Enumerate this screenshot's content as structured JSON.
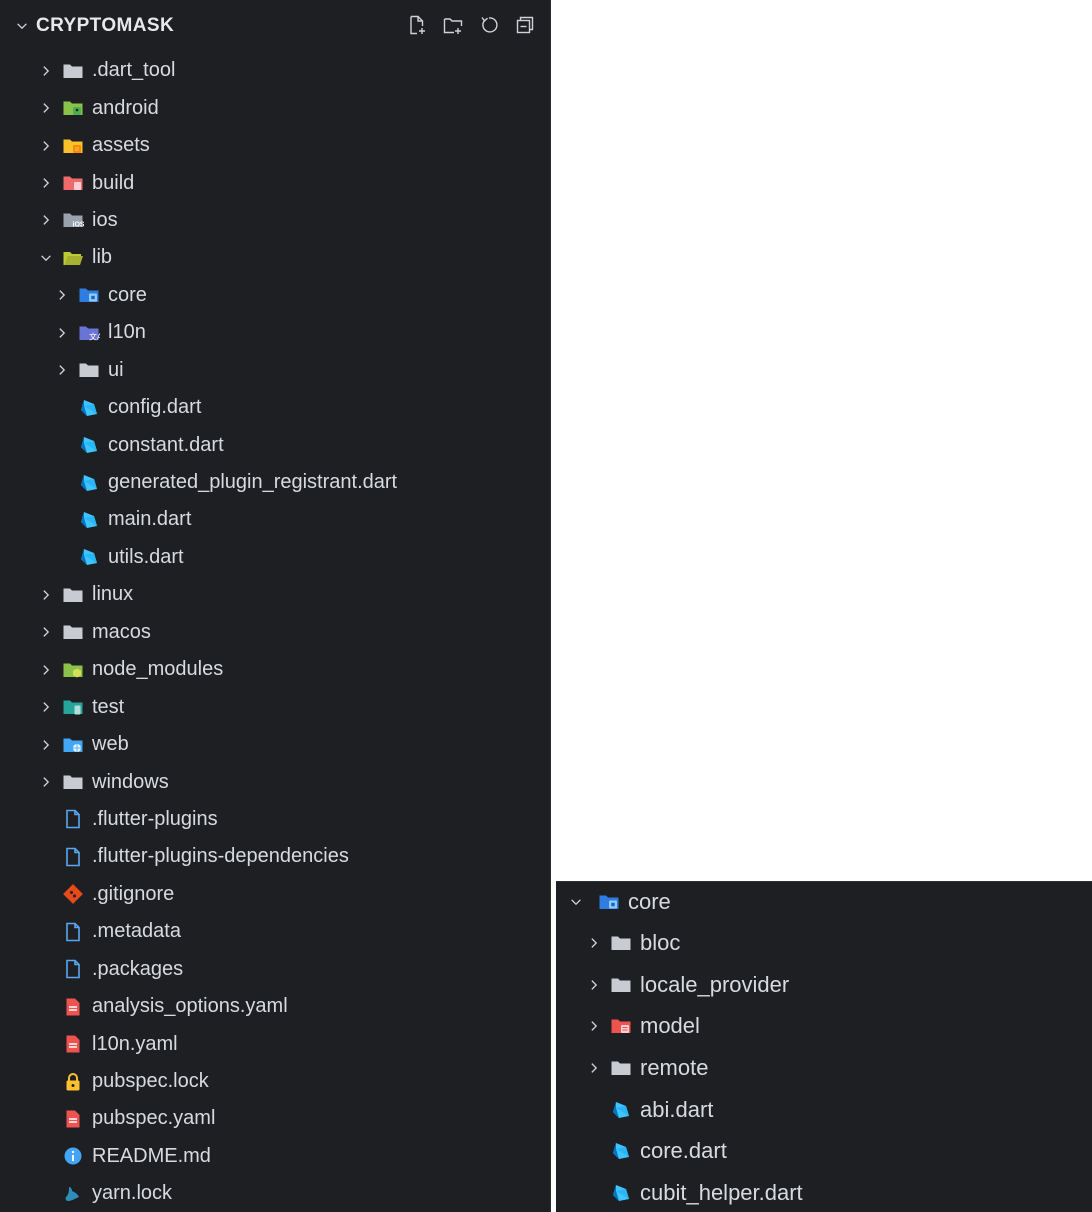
{
  "explorer": {
    "title": "CRYPTOMASK",
    "actions": [
      "new-file-icon",
      "new-folder-icon",
      "refresh-icon",
      "collapse-all-icon"
    ],
    "rows": [
      {
        "label": ".dart_tool",
        "type": "folder",
        "level": 0,
        "expanded": false,
        "icon": "folder-icon",
        "color": "#c8ccd2"
      },
      {
        "label": "android",
        "type": "folder",
        "level": 0,
        "expanded": false,
        "icon": "android-folder-icon",
        "color": "#8bc34a"
      },
      {
        "label": "assets",
        "type": "folder",
        "level": 0,
        "expanded": false,
        "icon": "assets-folder-icon",
        "color": "#f9c22b"
      },
      {
        "label": "build",
        "type": "folder",
        "level": 0,
        "expanded": false,
        "icon": "build-folder-icon",
        "color": "#ef6b6b"
      },
      {
        "label": "ios",
        "type": "folder",
        "level": 0,
        "expanded": false,
        "icon": "ios-folder-icon",
        "color": "#9aa3ad"
      },
      {
        "label": "lib",
        "type": "folder",
        "level": 0,
        "expanded": true,
        "icon": "lib-folder-icon",
        "color": "#c0ca33"
      },
      {
        "label": "core",
        "type": "folder",
        "level": 1,
        "expanded": false,
        "icon": "core-folder-icon",
        "color": "#2f7de1"
      },
      {
        "label": "l10n",
        "type": "folder",
        "level": 1,
        "expanded": false,
        "icon": "l10n-folder-icon",
        "color": "#6a74d6"
      },
      {
        "label": "ui",
        "type": "folder",
        "level": 1,
        "expanded": false,
        "icon": "folder-icon",
        "color": "#c8ccd2"
      },
      {
        "label": "config.dart",
        "type": "file",
        "level": 1,
        "icon": "dart-icon"
      },
      {
        "label": "constant.dart",
        "type": "file",
        "level": 1,
        "icon": "dart-icon"
      },
      {
        "label": "generated_plugin_registrant.dart",
        "type": "file",
        "level": 1,
        "icon": "dart-icon"
      },
      {
        "label": "main.dart",
        "type": "file",
        "level": 1,
        "icon": "dart-icon"
      },
      {
        "label": "utils.dart",
        "type": "file",
        "level": 1,
        "icon": "dart-icon"
      },
      {
        "label": "linux",
        "type": "folder",
        "level": 0,
        "expanded": false,
        "icon": "folder-icon",
        "color": "#c8ccd2"
      },
      {
        "label": "macos",
        "type": "folder",
        "level": 0,
        "expanded": false,
        "icon": "folder-icon",
        "color": "#c8ccd2"
      },
      {
        "label": "node_modules",
        "type": "folder",
        "level": 0,
        "expanded": false,
        "icon": "node-folder-icon",
        "color": "#8bc34a"
      },
      {
        "label": "test",
        "type": "folder",
        "level": 0,
        "expanded": false,
        "icon": "test-folder-icon",
        "color": "#26a69a"
      },
      {
        "label": "web",
        "type": "folder",
        "level": 0,
        "expanded": false,
        "icon": "web-folder-icon",
        "color": "#42a5f5"
      },
      {
        "label": "windows",
        "type": "folder",
        "level": 0,
        "expanded": false,
        "icon": "folder-icon",
        "color": "#c8ccd2"
      },
      {
        "label": ".flutter-plugins",
        "type": "file",
        "level": 0,
        "icon": "file-icon"
      },
      {
        "label": ".flutter-plugins-dependencies",
        "type": "file",
        "level": 0,
        "icon": "file-icon"
      },
      {
        "label": ".gitignore",
        "type": "file",
        "level": 0,
        "icon": "git-icon"
      },
      {
        "label": ".metadata",
        "type": "file",
        "level": 0,
        "icon": "file-icon"
      },
      {
        "label": ".packages",
        "type": "file",
        "level": 0,
        "icon": "file-icon"
      },
      {
        "label": "analysis_options.yaml",
        "type": "file",
        "level": 0,
        "icon": "yaml-icon"
      },
      {
        "label": "l10n.yaml",
        "type": "file",
        "level": 0,
        "icon": "yaml-icon"
      },
      {
        "label": "pubspec.lock",
        "type": "file",
        "level": 0,
        "icon": "lock-icon"
      },
      {
        "label": "pubspec.yaml",
        "type": "file",
        "level": 0,
        "icon": "yaml-icon"
      },
      {
        "label": "README.md",
        "type": "file",
        "level": 0,
        "icon": "info-icon"
      },
      {
        "label": "yarn.lock",
        "type": "file",
        "level": 0,
        "icon": "yarn-icon"
      }
    ]
  },
  "core_panel": {
    "title": "core",
    "icon": "core-folder-icon",
    "rows": [
      {
        "label": "bloc",
        "type": "folder",
        "expanded": false,
        "icon": "folder-icon",
        "color": "#c8ccd2"
      },
      {
        "label": "locale_provider",
        "type": "folder",
        "expanded": false,
        "icon": "folder-icon",
        "color": "#c8ccd2"
      },
      {
        "label": "model",
        "type": "folder",
        "expanded": false,
        "icon": "model-folder-icon",
        "color": "#ef5350"
      },
      {
        "label": "remote",
        "type": "folder",
        "expanded": false,
        "icon": "folder-icon",
        "color": "#c8ccd2"
      },
      {
        "label": "abi.dart",
        "type": "file",
        "icon": "dart-icon"
      },
      {
        "label": "core.dart",
        "type": "file",
        "icon": "dart-icon"
      },
      {
        "label": "cubit_helper.dart",
        "type": "file",
        "icon": "dart-icon"
      }
    ]
  }
}
